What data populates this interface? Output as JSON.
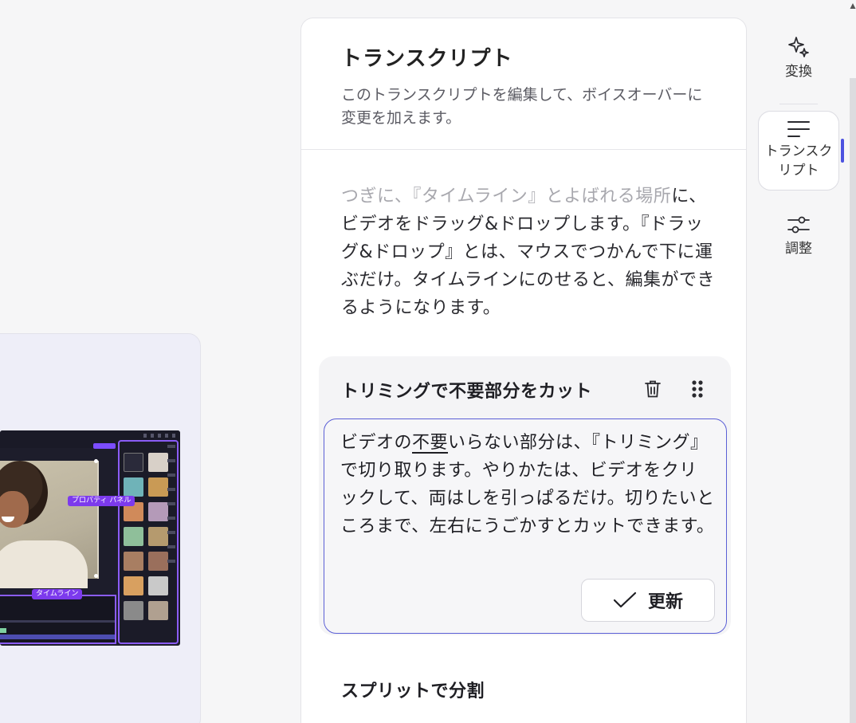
{
  "preview": {
    "property_panel_tag": "プロパティ パネル",
    "timeline_tag": "タイムライン"
  },
  "transcript": {
    "title": "トランスクリプト",
    "description": "このトランスクリプトを編集して、ボイスオーバーに変更を加えます。",
    "intro_faded": "つぎに、『タイムライン』とよばれる場所",
    "intro_main": "に、ビデオをドラッグ&ドロップします。『ドラッグ&ドロップ』とは、マウスでつかんで下に運ぶだけ。タイムラインにのせると、編集ができるようになります。",
    "section": {
      "title": "トリミングで不要部分をカット",
      "text_before": "ビデオの",
      "text_underlined": "不要",
      "text_after": "いらない部分は、『トリミング』で切り取ります。やりかたは、ビデオをクリックして、両はしを引っぱるだけ。切りたいところまで、左右にうごかすとカットできます。",
      "update_label": "更新",
      "delete_icon": "trash-icon",
      "drag_icon": "drag-handle-icon"
    },
    "next_section_title": "スプリットで分割"
  },
  "nav": {
    "items": [
      {
        "label": "変換",
        "icon": "sparkle-icon"
      },
      {
        "label": "トランスクリプト",
        "icon": "lines-icon",
        "active": true
      },
      {
        "label": "調整",
        "icon": "sliders-icon"
      }
    ]
  },
  "colors": {
    "accent": "#5b5fd6",
    "indicator": "#4c52e0",
    "tag_purple": "#7c3aed"
  }
}
